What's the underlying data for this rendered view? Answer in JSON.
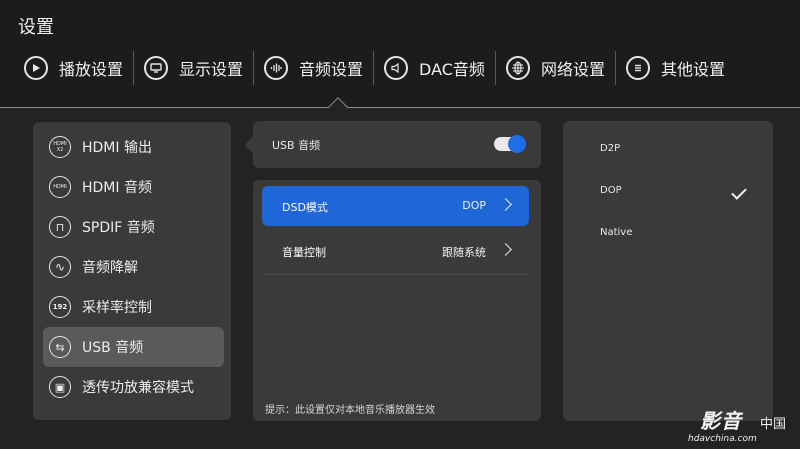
{
  "page": {
    "title": "设置"
  },
  "tabs": [
    {
      "label": "播放设置",
      "icon": "play-icon"
    },
    {
      "label": "显示设置",
      "icon": "display-icon"
    },
    {
      "label": "音频设置",
      "icon": "audio-wave-icon"
    },
    {
      "label": "DAC音频",
      "icon": "speaker-icon"
    },
    {
      "label": "网络设置",
      "icon": "globe-icon"
    },
    {
      "label": "其他设置",
      "icon": "menu-icon"
    }
  ],
  "sidebar": {
    "items": [
      {
        "label": "HDMI 输出",
        "icon": "hdmi-x2-icon",
        "icon_text": "HDMI X2"
      },
      {
        "label": "HDMI 音频",
        "icon": "hdmi-icon",
        "icon_text": "HDMI"
      },
      {
        "label": "SPDIF 音频",
        "icon": "spdif-icon",
        "icon_text": "⊓"
      },
      {
        "label": "音频降解",
        "icon": "waveform-icon",
        "icon_text": "∿"
      },
      {
        "label": "采样率控制",
        "icon": "sample-rate-icon",
        "icon_text": "192"
      },
      {
        "label": "USB 音频",
        "icon": "usb-icon",
        "icon_text": "⇆",
        "active": true
      },
      {
        "label": "透传功放兼容模式",
        "icon": "amp-icon",
        "icon_text": "▣"
      }
    ]
  },
  "usb": {
    "label": "USB 音频",
    "enabled": true,
    "accent": "#1e6ee6"
  },
  "options": [
    {
      "label": "DSD模式",
      "value": "DOP",
      "active": true
    },
    {
      "label": "音量控制",
      "value": "跟随系统",
      "active": false
    }
  ],
  "hint": "提示：此设置仅对本地音乐播放器生效",
  "choices": [
    {
      "label": "D2P",
      "selected": false
    },
    {
      "label": "DOP",
      "selected": true
    },
    {
      "label": "Native",
      "selected": false
    }
  ],
  "watermark": {
    "main": "影音",
    "cn": "中国",
    "url": "hdavchina.com"
  }
}
